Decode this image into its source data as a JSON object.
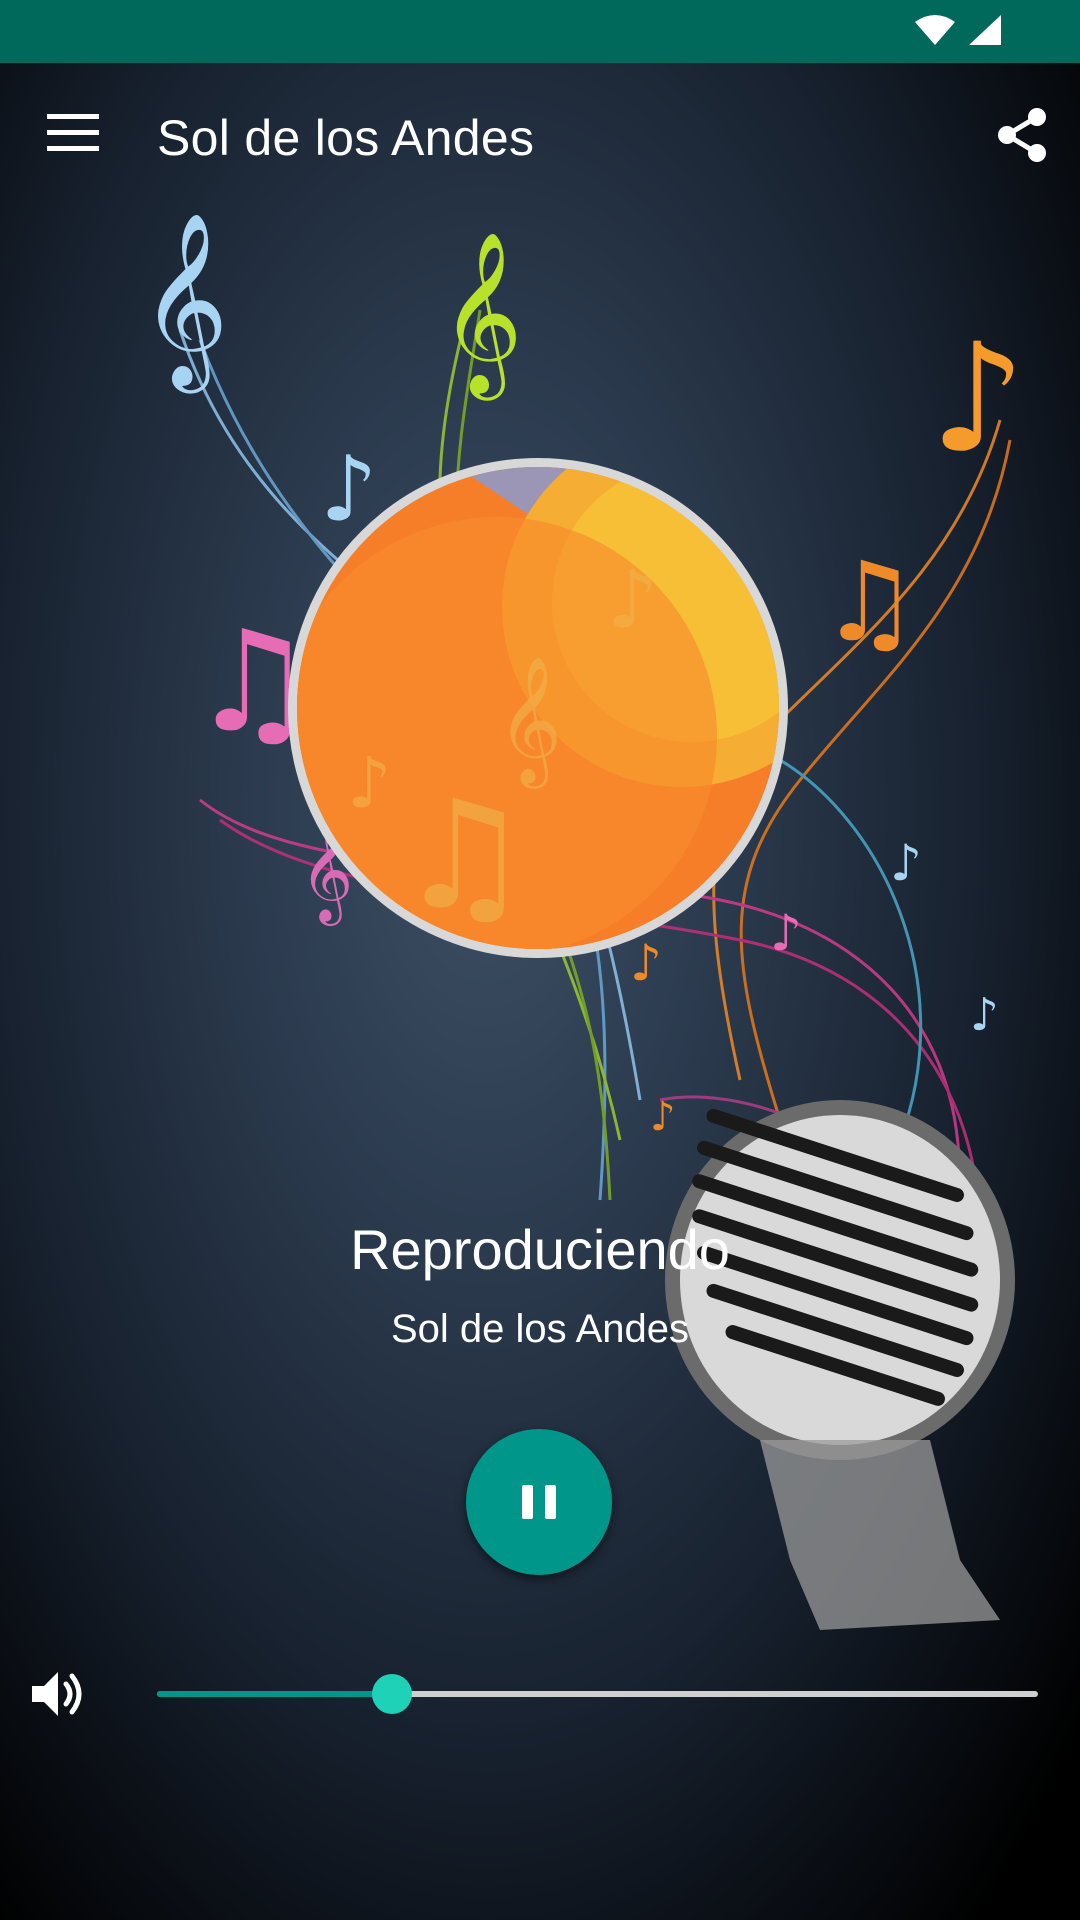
{
  "app": {
    "title": "Sol de los Andes"
  },
  "player": {
    "status": "Reproduciendo",
    "station": "Sol de los Andes",
    "volume_percent": 26.7
  },
  "colors": {
    "status_bar": "#00695c",
    "accent": "#00968a",
    "slider_thumb": "#1fd1b6",
    "cover_orange": "#f98a2c",
    "cover_yellow": "#f7d531"
  },
  "icons": {
    "menu": "menu-icon",
    "share": "share-icon",
    "pause": "pause-icon",
    "volume": "volume-icon",
    "wifi": "wifi-icon",
    "signal": "signal-icon"
  }
}
